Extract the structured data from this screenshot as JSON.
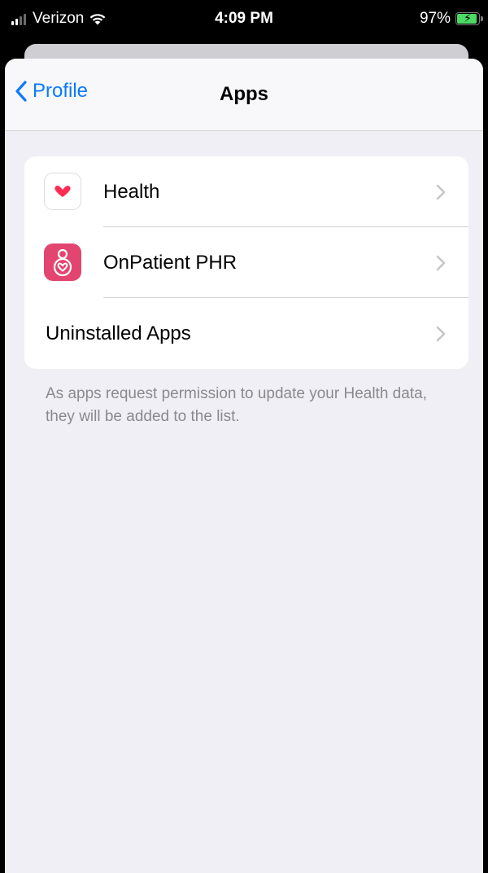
{
  "status_bar": {
    "carrier": "Verizon",
    "time": "4:09 PM",
    "battery_percent": "97%",
    "battery_level": 0.97
  },
  "nav": {
    "back_label": "Profile",
    "title": "Apps"
  },
  "list": {
    "items": [
      {
        "label": "Health",
        "icon": "health-heart-icon"
      },
      {
        "label": "OnPatient PHR",
        "icon": "onpatient-phr-icon"
      },
      {
        "label": "Uninstalled Apps",
        "icon": ""
      }
    ]
  },
  "footer_note": "As apps request permission to update your Health data, they will be added to the list.",
  "colors": {
    "accent": "#0a7aff",
    "health_heart": "#ff2d55",
    "onpatient": "#e2456f",
    "battery_charging": "#4cd964",
    "grouped_background": "#f0eff5"
  }
}
